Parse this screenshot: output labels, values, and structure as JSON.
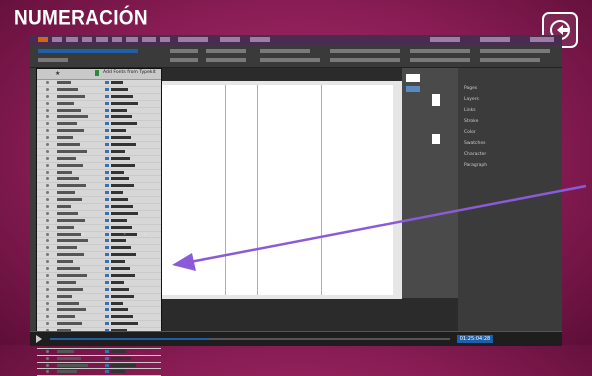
{
  "slide": {
    "title": "NUMERACIÓN"
  },
  "player": {
    "time": "01:25:04:28"
  },
  "app": {
    "font_panel_title": "Add Fonts from Typekit"
  },
  "panels": {
    "right_items": [
      "Pages",
      "Layers",
      "Links",
      "Stroke",
      "Color",
      "Swatches",
      "Character",
      "Paragraph"
    ]
  },
  "colors": {
    "background": "#9c2763",
    "accent": "#1d5fa8"
  }
}
